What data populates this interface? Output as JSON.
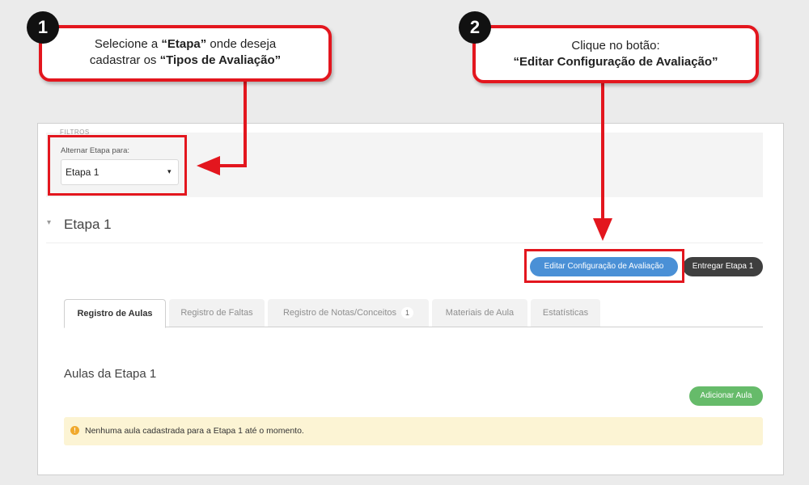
{
  "filters": {
    "title": "FILTROS",
    "stage_label": "Alternar Etapa para:",
    "stage_value": "Etapa 1",
    "caret": "▾"
  },
  "section": {
    "chevron": "▾",
    "heading": "Etapa 1"
  },
  "actions": {
    "edit_config": "Editar Configuração de Avaliação",
    "deliver_stage": "Entregar Etapa 1"
  },
  "tabs": [
    {
      "label": "Registro de Aulas",
      "active": true
    },
    {
      "label": "Registro de Faltas",
      "active": false
    },
    {
      "label": "Registro de Notas/Conceitos",
      "badge": "1",
      "active": false
    },
    {
      "label": "Materiais de Aula",
      "active": false
    },
    {
      "label": "Estatísticas",
      "active": false
    }
  ],
  "classes": {
    "title": "Aulas da Etapa 1",
    "add_button": "Adicionar Aula",
    "alert_icon": "!",
    "empty_message": "Nenhuma aula cadastrada para a Etapa 1 até o momento."
  },
  "annotations": {
    "step1": {
      "number": "1",
      "text_a": "Selecione a ",
      "bold_a": "“Etapa”",
      "text_b": " onde deseja",
      "text_c": "cadastrar os ",
      "bold_b": "“Tipos de Avaliação”"
    },
    "step2": {
      "number": "2",
      "line1": "Clique no botão:",
      "line2": "“Editar Configuração de Avaliação”"
    }
  },
  "colors": {
    "annotation_red": "#e3161e",
    "primary_blue": "#4a90d6",
    "dark_button": "#3f3f3f",
    "success_green": "#66bb6a",
    "alert_bg": "#fcf4d4"
  }
}
